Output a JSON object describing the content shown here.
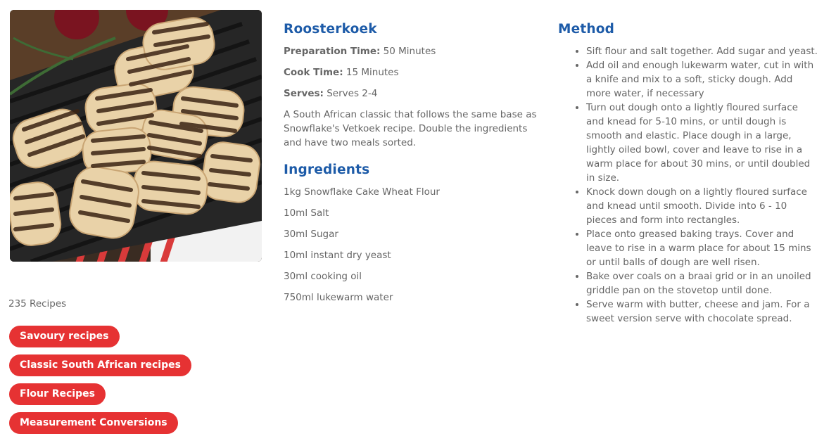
{
  "recipe": {
    "title": "Roosterkoek",
    "prep_label": "Preparation Time:",
    "prep_value": "50 Minutes",
    "cook_label": "Cook Time:",
    "cook_value": "15 Minutes",
    "serves_label": "Serves:",
    "serves_value": "Serves 2-4",
    "description": "A South African classic that follows the same base as Snowflake's Vetkoek recipe. Double the ingredients and have two meals sorted."
  },
  "ingredients": {
    "heading": "Ingredients",
    "items": [
      "1kg Snowflake Cake Wheat Flour",
      "10ml Salt",
      "30ml Sugar",
      "10ml instant dry yeast",
      "30ml cooking oil",
      "750ml lukewarm water"
    ]
  },
  "method": {
    "heading": "Method",
    "steps": [
      "Sift flour and salt together. Add sugar and yeast.",
      "Add oil and enough lukewarm water, cut in with a knife and mix to a soft, sticky dough. Add more water, if necessary",
      "Turn out dough onto a lightly floured surface and knead for 5-10 mins, or until dough is smooth and elastic. Place dough in a large, lightly oiled bowl, cover and leave to rise in a warm place for about 30 mins, or until doubled in size.",
      "Knock down dough on a lightly floured surface and knead until smooth. Divide into 6 - 10 pieces and form into rectangles.",
      "Place onto greased baking trays. Cover and leave to rise in a warm place for about 15 mins or until balls of dough are well risen.",
      "Bake over coals on a braai grid or in an unoiled griddle pan on the stovetop until done.",
      "Serve warm with butter, cheese and jam. For a sweet version serve with chocolate spread."
    ]
  },
  "sidebar": {
    "recipe_count": "235 Recipes",
    "tags": [
      "Savoury recipes",
      "Classic South African recipes",
      "Flour Recipes",
      "Measurement Conversions"
    ]
  },
  "colors": {
    "accent_blue": "#1d5ba8",
    "tag_red": "#e63233",
    "text_grey": "#666666"
  }
}
